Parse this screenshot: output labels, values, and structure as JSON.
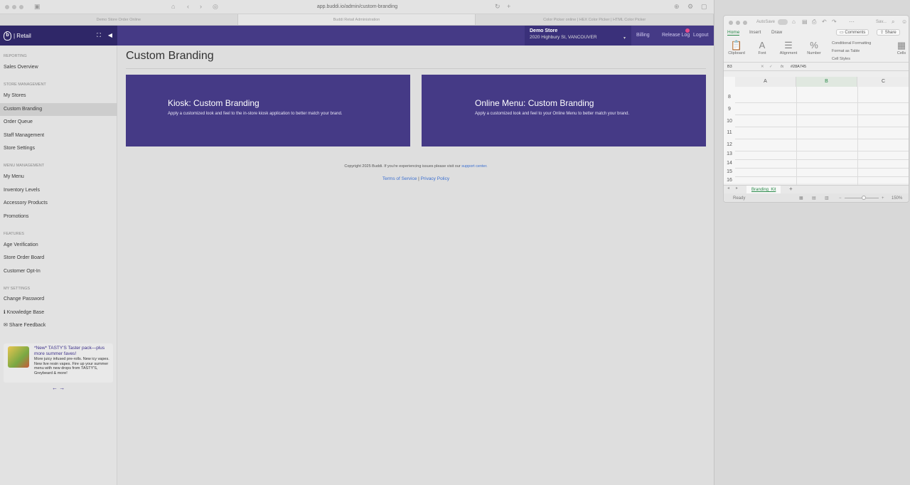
{
  "browser": {
    "url": "app.buddi.io/admin/custom-branding",
    "tabs": [
      "Demo Store Order Online",
      "Buddi Retail Administration",
      "Color Picker online | HEX Color Picker | HTML Color Picker"
    ]
  },
  "app": {
    "logo_text": "| Retail",
    "store_name": "Demo Store",
    "store_address": "2020 Highbury St, VANCOUVER",
    "nav": {
      "billing": "Billing",
      "release_log": "Release Log",
      "logout": "Logout"
    }
  },
  "sidebar": {
    "sections": [
      {
        "title": "REPORTING",
        "items": [
          "Sales Overview"
        ]
      },
      {
        "title": "STORE MANAGEMENT",
        "items": [
          "My Stores",
          "Custom Branding",
          "Order Queue",
          "Staff Management",
          "Store Settings"
        ]
      },
      {
        "title": "MENU MANAGEMENT",
        "items": [
          "My Menu",
          "Inventory Levels",
          "Accessory Products",
          "Promotions"
        ]
      },
      {
        "title": "FEATURES",
        "items": [
          "Age Verification",
          "Store Order Board",
          "Customer Opt-In"
        ]
      },
      {
        "title": "MY SETTINGS",
        "items": [
          "Change Password",
          "Knowledge Base",
          "Share Feedback"
        ]
      }
    ],
    "active_item": "Custom Branding",
    "promo": {
      "title": "*New* TASTY'S Taster pack—plus more summer faves!",
      "body": "More juicy infused pre-rolls. New icy vapes. New live resin vapes. Fire up your summer menu with new drops from TASTY'S, Greybeard & more!"
    }
  },
  "main": {
    "page_title": "Custom Branding",
    "cards": [
      {
        "title": "Kiosk: Custom Branding",
        "description": "Apply a customized look and feel to the in-store kiosk application to better match your brand."
      },
      {
        "title": "Online Menu: Custom Branding",
        "description": "Apply a customized look and feel to your Online Menu to better match your brand."
      }
    ],
    "footer": {
      "copyright": "Copyright 2025 Buddi. If you're experiencing issues please visit our ",
      "support_link": "support center.",
      "terms": "Terms of Service",
      "separator": " | ",
      "privacy": "Privacy Policy"
    }
  },
  "excel": {
    "autosave": "AutoSave",
    "title": "Sav...",
    "ribbon_tabs": [
      "Home",
      "Insert",
      "Draw"
    ],
    "comments": "Comments",
    "share": "Share",
    "groups": [
      "Clipboard",
      "Font",
      "Alignment",
      "Number"
    ],
    "styles": [
      "Conditional Formatting",
      "Format as Table",
      "Cell Styles"
    ],
    "cells_label": "Cells",
    "cell_ref": "B3",
    "fx": "fx",
    "formula": "#28A745",
    "columns": [
      "A",
      "B",
      "C"
    ],
    "rows": [
      "8",
      "9",
      "10",
      "11",
      "12",
      "13",
      "14",
      "15",
      "16"
    ],
    "sheet_tab": "Branding_Kit",
    "add_sheet": "+",
    "status": "Ready",
    "zoom": "150%"
  }
}
